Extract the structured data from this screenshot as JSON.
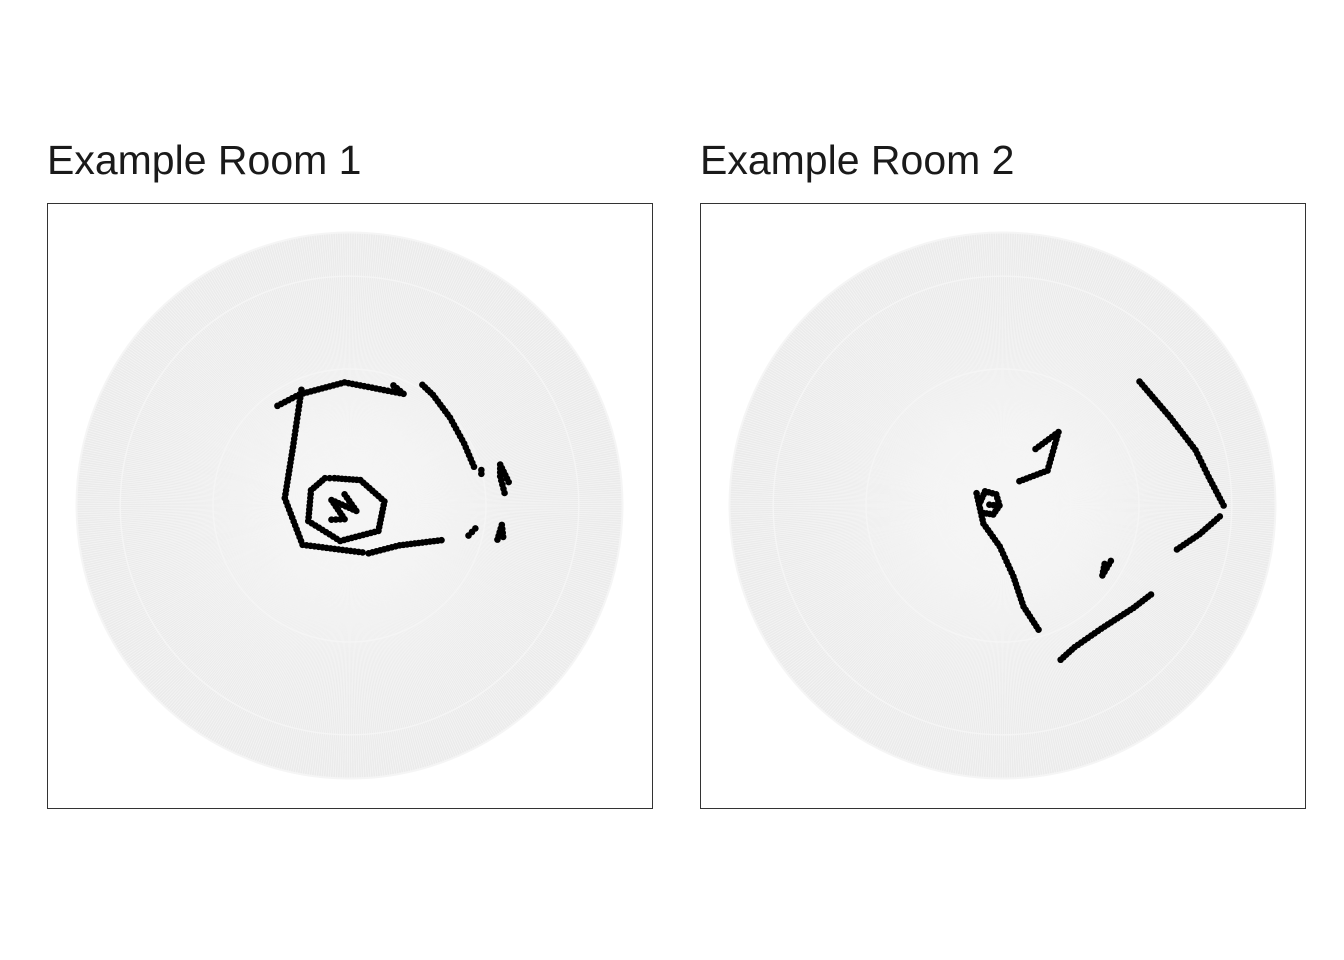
{
  "chart_data": [
    {
      "type": "scatter",
      "coord": "polar",
      "title": "Example Room 1",
      "xlabel": "",
      "ylabel": "",
      "grid": true,
      "background": "#ebebeb",
      "grid_color": "#f5f5f5",
      "point_color": "#000000",
      "r_max": 1.0,
      "segments": [
        [
          [
            -0.264,
            0.365
          ],
          [
            -0.183,
            0.407
          ],
          [
            -0.018,
            0.451
          ],
          [
            0.198,
            0.409
          ],
          [
            0.161,
            0.44
          ]
        ],
        [
          [
            0.267,
            0.442
          ],
          [
            0.306,
            0.405
          ],
          [
            0.368,
            0.322
          ],
          [
            0.42,
            0.227
          ],
          [
            0.456,
            0.142
          ]
        ],
        [
          [
            -0.176,
            0.424
          ],
          [
            -0.207,
            0.214
          ],
          [
            -0.237,
            0.027
          ],
          [
            -0.172,
            -0.144
          ],
          [
            0.048,
            -0.172
          ]
        ],
        [
          [
            0.07,
            -0.175
          ],
          [
            0.183,
            -0.146
          ],
          [
            0.337,
            -0.127
          ]
        ],
        [
          [
            0.436,
            -0.11
          ],
          [
            0.461,
            -0.084
          ]
        ],
        [
          [
            0.563,
            -0.115
          ],
          [
            0.558,
            -0.071
          ],
          [
            0.542,
            -0.125
          ]
        ],
        [
          [
            0.568,
            0.046
          ],
          [
            0.552,
            0.107
          ],
          [
            0.552,
            0.15
          ],
          [
            0.583,
            0.086
          ]
        ],
        [
          [
            0.483,
            0.13
          ],
          [
            0.483,
            0.116
          ]
        ],
        [
          [
            -0.066,
            -0.052
          ],
          [
            -0.018,
            -0.05
          ],
          [
            -0.066,
            0.02
          ],
          [
            0.025,
            -0.02
          ],
          [
            -0.018,
            0.041
          ]
        ],
        [
          [
            -0.055,
            0.1
          ],
          [
            0.04,
            0.093
          ],
          [
            0.128,
            0.015
          ],
          [
            0.106,
            -0.093
          ],
          [
            -0.034,
            -0.13
          ],
          [
            -0.151,
            -0.057
          ],
          [
            -0.141,
            0.056
          ],
          [
            -0.09,
            0.1
          ],
          [
            -0.055,
            0.1
          ]
        ]
      ]
    },
    {
      "type": "scatter",
      "coord": "polar",
      "title": "Example Room 2",
      "xlabel": "",
      "ylabel": "",
      "grid": true,
      "background": "#ebebeb",
      "grid_color": "#f5f5f5",
      "point_color": "#000000",
      "r_max": 1.0,
      "segments": [
        [
          [
            0.502,
            0.454
          ],
          [
            0.615,
            0.322
          ],
          [
            0.707,
            0.203
          ],
          [
            0.755,
            0.105
          ],
          [
            0.81,
            0.0
          ]
        ],
        [
          [
            0.796,
            -0.04
          ],
          [
            0.722,
            -0.105
          ],
          [
            0.639,
            -0.161
          ]
        ],
        [
          [
            0.544,
            -0.326
          ],
          [
            0.48,
            -0.375
          ],
          [
            0.362,
            -0.451
          ],
          [
            0.264,
            -0.519
          ],
          [
            0.213,
            -0.565
          ]
        ],
        [
          [
            -0.095,
            0.045
          ],
          [
            -0.07,
            -0.066
          ],
          [
            -0.01,
            -0.15
          ],
          [
            0.04,
            -0.26
          ],
          [
            0.077,
            -0.37
          ],
          [
            0.132,
            -0.455
          ]
        ],
        [
          [
            0.062,
            0.089
          ],
          [
            0.165,
            0.128
          ],
          [
            0.205,
            0.269
          ],
          [
            0.121,
            0.207
          ]
        ],
        [
          [
            0.374,
            -0.214
          ],
          [
            0.366,
            -0.256
          ],
          [
            0.397,
            -0.203
          ]
        ],
        [
          [
            -0.08,
            0.016
          ],
          [
            -0.064,
            0.052
          ],
          [
            -0.023,
            0.041
          ],
          [
            -0.011,
            0.0
          ],
          [
            -0.034,
            -0.033
          ],
          [
            -0.071,
            -0.027
          ]
        ],
        [
          [
            -0.048,
            0.003
          ],
          [
            -0.033,
            0.001
          ]
        ]
      ]
    }
  ]
}
